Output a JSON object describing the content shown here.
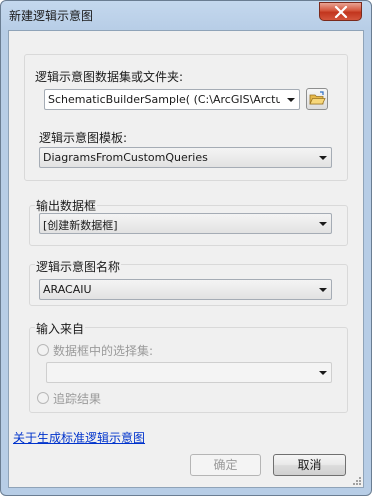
{
  "window": {
    "title": "新建逻辑示意图"
  },
  "dataset": {
    "label": "逻辑示意图数据集或文件夹:",
    "value": "SchematicBuilderSample( (C:\\ArcGIS\\Arctutor Sch\\"
  },
  "template": {
    "label": "逻辑示意图模板:",
    "value": "DiagramsFromCustomQueries"
  },
  "output_frame": {
    "label": "输出数据框",
    "value": "[创建新数据框]"
  },
  "diagram_name": {
    "label": "逻辑示意图名称",
    "value": "ARACAIU"
  },
  "input_from": {
    "label": "输入来自",
    "selection_label": "数据框中的选择集:",
    "selection_value": "",
    "trace_label": "追踪结果"
  },
  "help_link": "关于生成标准逻辑示意图",
  "buttons": {
    "ok": "确定",
    "cancel": "取消"
  },
  "colors": {
    "link": "#0033cc",
    "close": "#c2351d"
  }
}
